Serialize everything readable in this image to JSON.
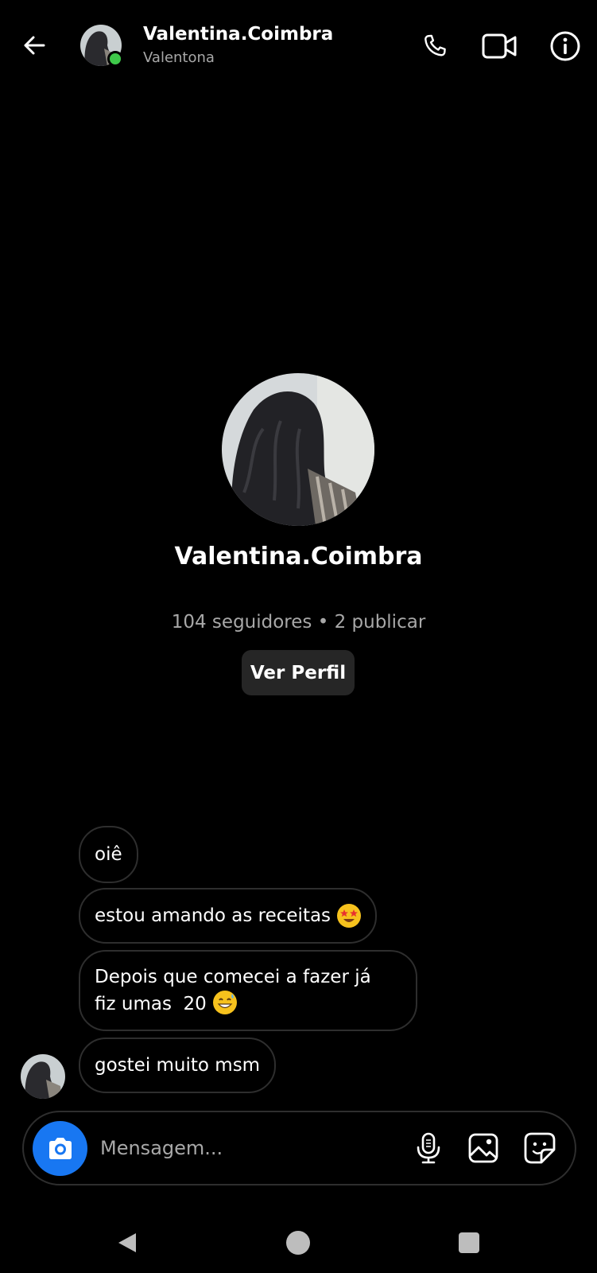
{
  "header": {
    "back_icon": "arrow-left-icon",
    "name": "Valentina.Coimbra",
    "subtitle": "Valentona",
    "online_color": "#3ec94a",
    "icons": [
      "phone-icon",
      "video-camera-icon",
      "info-icon"
    ]
  },
  "profile": {
    "name": "Valentina.Coimbra",
    "stats": "104 seguidores • 2 publicar",
    "view_profile_label": "Ver Perfil"
  },
  "messages": [
    {
      "text": "oiê"
    },
    {
      "text": "estou amando as receitas",
      "emoji": "star-struck-emoji"
    },
    {
      "lines": [
        "Depois que comecei a fazer já",
        "fiz umas  20"
      ],
      "emoji": "grinning-sweat-emoji"
    },
    {
      "text": "gostei muito msm"
    }
  ],
  "composer": {
    "placeholder": "Mensagem...",
    "accent": "#1877f2",
    "icons": [
      "camera-icon",
      "microphone-icon",
      "gallery-icon",
      "sticker-icon"
    ]
  },
  "navbar": {
    "icons": [
      "nav-back-icon",
      "nav-home-icon",
      "nav-recents-icon"
    ]
  }
}
